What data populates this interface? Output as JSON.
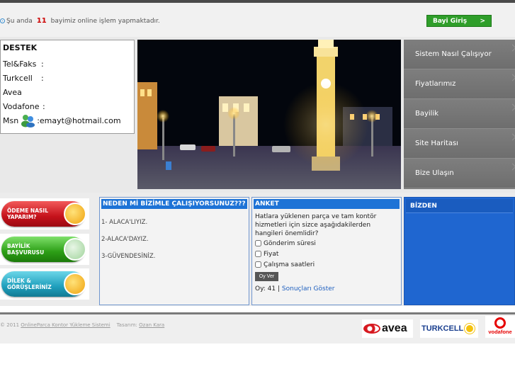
{
  "header": {
    "online_prefix": "Şu anda",
    "online_count": "11",
    "online_suffix": "bayimiz online işlem yapmaktadır.",
    "login_button": "Bayi Giriş",
    "login_arrow": ">"
  },
  "destek": {
    "title": "DESTEK",
    "rows": [
      {
        "label": "Tel&Faks",
        "sep": ":"
      },
      {
        "label": "Turkcell",
        "sep": ":"
      },
      {
        "label": "Avea",
        "sep": ""
      },
      {
        "label": "Vodafone",
        "sep": ":"
      }
    ],
    "msn_label": "Msn",
    "msn_value": ":emayt@hotmail.com"
  },
  "nav": {
    "items": [
      "Sistem Nasıl Çalışıyor",
      "Fiyatlarımız",
      "Bayilik",
      "Site Haritası",
      "Bize Ulaşın"
    ]
  },
  "side_buttons": [
    {
      "line1": "ÖDEME NASIL",
      "line2": "YAPARIM?",
      "icon": "coins-icon"
    },
    {
      "line1": "BAYİLİK",
      "line2": "BAŞVURUSU",
      "icon": "handshake-icon"
    },
    {
      "line1": "DİLEK &",
      "line2": "GÖRÜŞLERİNİZ",
      "icon": "alert-icon"
    }
  ],
  "neden": {
    "title": "NEDEN Mİ BİZİMLE ÇALIŞIYORSUNUZ???",
    "lines": [
      "1- ALACA'LIYIZ.",
      "2-ALACA'DAYIZ.",
      "3-GÜVENDESİNİZ."
    ]
  },
  "anket": {
    "title": "ANKET",
    "question": "Hatlara yüklenen parça ve tam kontör hizmetleri için sizce aşağıdakilerden hangileri önemlidir?",
    "options": [
      "Gönderim süresi",
      "Fiyat",
      "Çalışma saatleri"
    ],
    "vote_button": "Oy Ver",
    "votes_label": "Oy: 41",
    "separator": "|",
    "results_link": "Sonuçları Göster"
  },
  "bizden": {
    "title": "BİZDEN"
  },
  "footer": {
    "copyright": "© 2011",
    "site_link": "OnlineParca Kontor Yükleme Sistemi",
    "designer_label": "Tasarım:",
    "designer_link": "Ozan Kara"
  },
  "logos": {
    "avea": "avea",
    "turkcell": "TURKCELL",
    "vodafone": "vodafone"
  },
  "colors": {
    "accent_blue": "#1e73d6",
    "login_green": "#2f9e2a",
    "nav_gray": "#767676",
    "online_count_red": "#cc0000"
  }
}
